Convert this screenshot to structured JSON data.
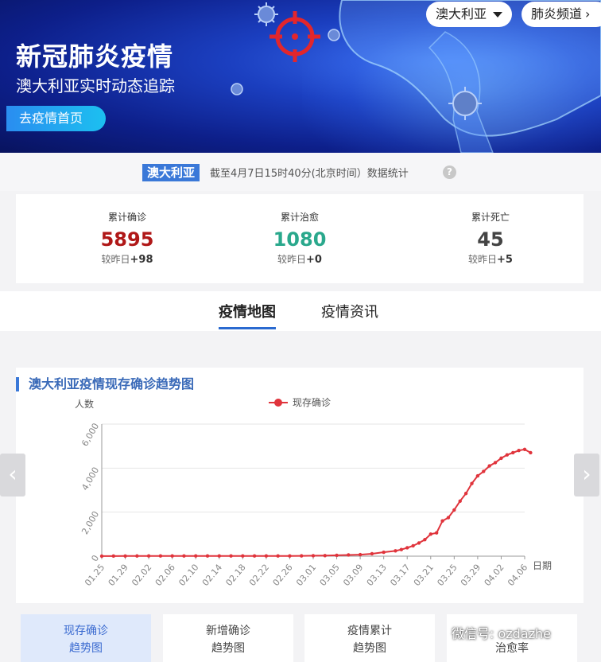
{
  "banner": {
    "title": "新冠肺炎疫情",
    "subtitle": "澳大利亚实时动态追踪",
    "home_button": "去疫情首页",
    "region_select": "澳大利亚",
    "channel_button": "肺炎频道"
  },
  "stats_bar": {
    "region_tag": "澳大利亚",
    "asof": "截至4月7日15时40分(北京时间）数据统计"
  },
  "stats": [
    {
      "label": "累计确诊",
      "value": "5895",
      "delta_prefix": "较昨日",
      "delta": "+98",
      "color": "#b01818"
    },
    {
      "label": "累计治愈",
      "value": "1080",
      "delta_prefix": "较昨日",
      "delta": "+0",
      "color": "#2aa88c"
    },
    {
      "label": "累计死亡",
      "value": "45",
      "delta_prefix": "较昨日",
      "delta": "+5",
      "color": "#444444"
    }
  ],
  "tabs": {
    "map": "疫情地图",
    "news": "疫情资讯"
  },
  "chart_title": "澳大利亚疫情现存确诊趋势图",
  "chart_data": {
    "type": "line",
    "ylabel": "人数",
    "xlabel": "日期",
    "legend": "现存确诊",
    "legend_position": "top-center",
    "color": "#e0343c",
    "ylim": [
      0,
      6000
    ],
    "yticks": [
      "0",
      "2,000",
      "4,000",
      "6,000"
    ],
    "xticks": [
      "01.25",
      "01.29",
      "02.02",
      "02.06",
      "02.10",
      "02.14",
      "02.18",
      "02.22",
      "02.26",
      "03.01",
      "03.05",
      "03.09",
      "03.13",
      "03.17",
      "03.21",
      "03.25",
      "03.29",
      "04.02",
      "04.06"
    ],
    "x": [
      "01.25",
      "01.27",
      "01.29",
      "01.31",
      "02.02",
      "02.04",
      "02.06",
      "02.08",
      "02.10",
      "02.12",
      "02.14",
      "02.16",
      "02.18",
      "02.20",
      "02.22",
      "02.24",
      "02.26",
      "02.28",
      "03.01",
      "03.03",
      "03.05",
      "03.07",
      "03.09",
      "03.11",
      "03.13",
      "03.15",
      "03.16",
      "03.17",
      "03.18",
      "03.19",
      "03.20",
      "03.21",
      "03.22",
      "03.23",
      "03.24",
      "03.25",
      "03.26",
      "03.27",
      "03.28",
      "03.29",
      "03.30",
      "03.31",
      "04.01",
      "04.02",
      "04.03",
      "04.04",
      "04.05",
      "04.06",
      "04.07"
    ],
    "values": [
      4,
      5,
      7,
      9,
      10,
      10,
      12,
      12,
      12,
      12,
      12,
      12,
      12,
      12,
      12,
      12,
      12,
      14,
      20,
      25,
      40,
      55,
      70,
      110,
      180,
      240,
      300,
      380,
      470,
      600,
      750,
      1000,
      1060,
      1600,
      1750,
      2100,
      2500,
      2850,
      3300,
      3650,
      3850,
      4100,
      4250,
      4450,
      4600,
      4700,
      4800,
      4850,
      4700
    ]
  },
  "bottom_tabs": [
    {
      "line1": "现存确诊",
      "line2": "趋势图"
    },
    {
      "line1": "新增确诊",
      "line2": "趋势图"
    },
    {
      "line1": "疫情累计",
      "line2": "趋势图"
    },
    {
      "line1": "",
      "line2": "治愈率"
    }
  ],
  "watermark": "微信号: ozdazhe"
}
